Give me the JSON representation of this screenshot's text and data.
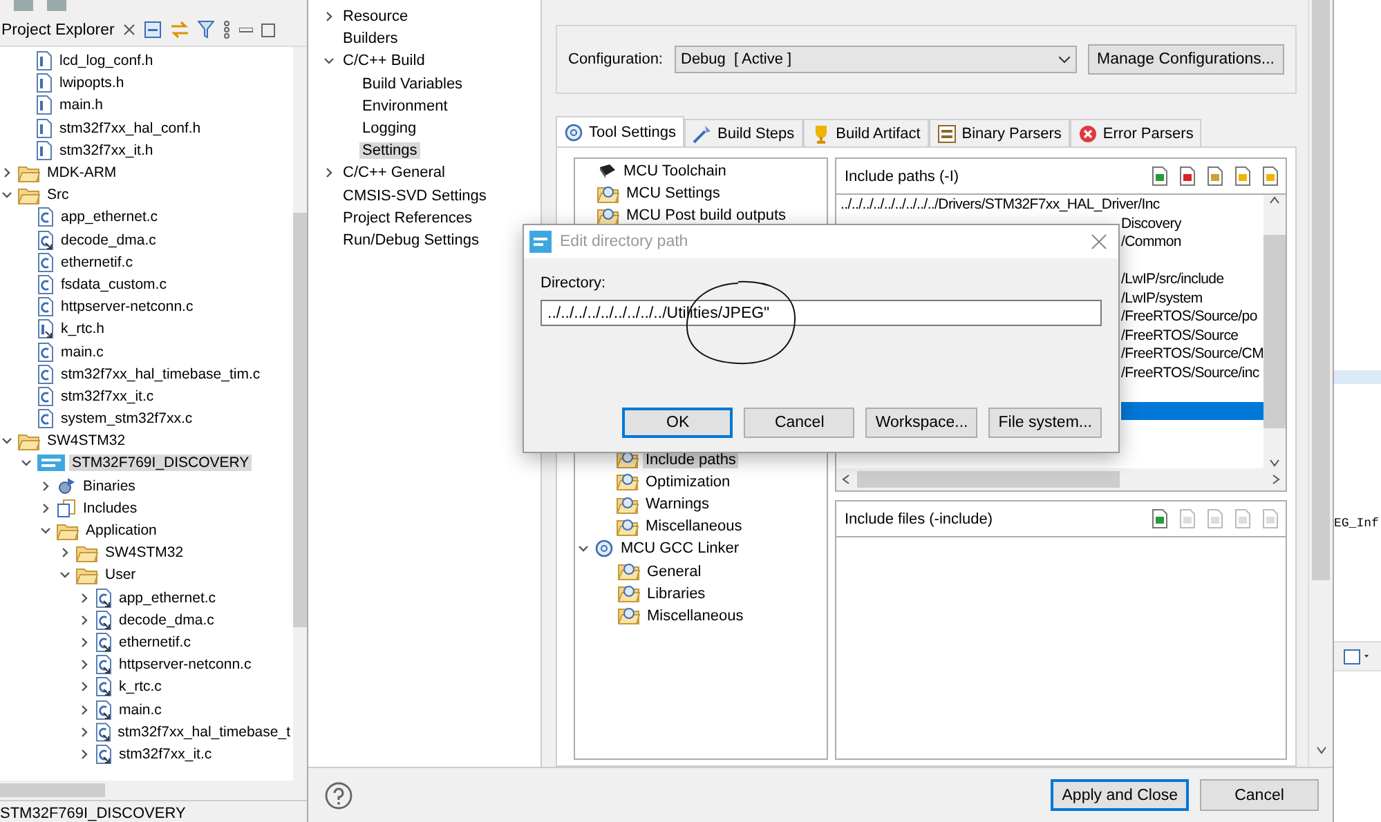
{
  "explorer": {
    "title": "Project Explorer",
    "partial_folder_items": [
      {
        "label": "lcd_log_conf.h",
        "kind": "h-file",
        "selected": false
      },
      {
        "label": "lwipopts.h",
        "kind": "h-file",
        "selected": false
      },
      {
        "label": "main.h",
        "kind": "h-file",
        "selected": false
      },
      {
        "label": "stm32f7xx_hal_conf.h",
        "kind": "h-file",
        "selected": false
      },
      {
        "label": "stm32f7xx_it.h",
        "kind": "h-file",
        "selected": false
      }
    ],
    "tree": [
      {
        "label": "MDK-ARM",
        "kind": "folder",
        "expanded": false,
        "selected": false
      },
      {
        "label": "Src",
        "kind": "folder",
        "expanded": true,
        "selected": false,
        "children": [
          {
            "label": "app_ethernet.c",
            "kind": "c-file",
            "selected": false
          },
          {
            "label": "decode_dma.c",
            "kind": "c-file-linked",
            "selected": false
          },
          {
            "label": "ethernetif.c",
            "kind": "c-file",
            "selected": false
          },
          {
            "label": "fsdata_custom.c",
            "kind": "c-file",
            "selected": false
          },
          {
            "label": "httpserver-netconn.c",
            "kind": "c-file",
            "selected": false
          },
          {
            "label": "k_rtc.h",
            "kind": "h-file-linked",
            "selected": false
          },
          {
            "label": "main.c",
            "kind": "c-file",
            "selected": false
          },
          {
            "label": "stm32f7xx_hal_timebase_tim.c",
            "kind": "c-file",
            "selected": false
          },
          {
            "label": "stm32f7xx_it.c",
            "kind": "c-file",
            "selected": false
          },
          {
            "label": "system_stm32f7xx.c",
            "kind": "c-file",
            "selected": false
          }
        ]
      },
      {
        "label": "SW4STM32",
        "kind": "folder",
        "expanded": true,
        "selected": false,
        "children": [
          {
            "label": "STM32F769I_DISCOVERY",
            "kind": "project",
            "expanded": true,
            "selected": true,
            "children": [
              {
                "label": "Binaries",
                "kind": "binaries",
                "expanded": false,
                "selected": false
              },
              {
                "label": "Includes",
                "kind": "includes",
                "expanded": false,
                "selected": false
              },
              {
                "label": "Application",
                "kind": "folder",
                "expanded": true,
                "selected": false,
                "children": [
                  {
                    "label": "SW4STM32",
                    "kind": "folder",
                    "expanded": false,
                    "selected": false
                  },
                  {
                    "label": "User",
                    "kind": "folder",
                    "expanded": true,
                    "selected": false,
                    "children": [
                      {
                        "label": "app_ethernet.c",
                        "kind": "c-file-linked",
                        "expanded": false,
                        "selected": false
                      },
                      {
                        "label": "decode_dma.c",
                        "kind": "c-file-linked",
                        "expanded": false,
                        "selected": false
                      },
                      {
                        "label": "ethernetif.c",
                        "kind": "c-file-linked",
                        "expanded": false,
                        "selected": false
                      },
                      {
                        "label": "httpserver-netconn.c",
                        "kind": "c-file-linked",
                        "expanded": false,
                        "selected": false
                      },
                      {
                        "label": "k_rtc.c",
                        "kind": "c-file-linked",
                        "expanded": false,
                        "selected": false
                      },
                      {
                        "label": "main.c",
                        "kind": "c-file-linked",
                        "expanded": false,
                        "selected": false
                      },
                      {
                        "label": "stm32f7xx_hal_timebase_t",
                        "kind": "c-file-linked",
                        "expanded": false,
                        "selected": false
                      },
                      {
                        "label": "stm32f7xx_it.c",
                        "kind": "c-file-linked",
                        "expanded": false,
                        "selected": false
                      }
                    ]
                  }
                ]
              }
            ]
          }
        ]
      }
    ],
    "status": "STM32F769I_DISCOVERY"
  },
  "properties": {
    "nav": [
      {
        "label": "Resource",
        "expanded": false,
        "selected": false
      },
      {
        "label": "Builders",
        "selected": false
      },
      {
        "label": "C/C++ Build",
        "expanded": true,
        "selected": false,
        "children": [
          {
            "label": "Build Variables",
            "selected": false
          },
          {
            "label": "Environment",
            "selected": false
          },
          {
            "label": "Logging",
            "selected": false
          },
          {
            "label": "Settings",
            "selected": true
          }
        ]
      },
      {
        "label": "C/C++ General",
        "expanded": false,
        "selected": false
      },
      {
        "label": "CMSIS-SVD Settings",
        "selected": false
      },
      {
        "label": "Project References",
        "selected": false
      },
      {
        "label": "Run/Debug Settings",
        "selected": false
      }
    ],
    "configuration": {
      "label": "Configuration:",
      "value": "Debug  [ Active ]",
      "manage_button": "Manage Configurations..."
    },
    "tabs": [
      {
        "label": "Tool Settings",
        "kind": "gear",
        "selected": true
      },
      {
        "label": "Build Steps",
        "kind": "wand",
        "selected": false
      },
      {
        "label": "Build Artifact",
        "kind": "trophy",
        "selected": false
      },
      {
        "label": "Binary Parsers",
        "kind": "binary",
        "selected": false
      },
      {
        "label": "Error Parsers",
        "kind": "error",
        "selected": false
      }
    ],
    "tool_tree_top": [
      {
        "label": "MCU Toolchain",
        "kind": "chip",
        "selected": false
      },
      {
        "label": "MCU Settings",
        "kind": "tool-folder",
        "selected": false
      },
      {
        "label": "MCU Post build outputs",
        "kind": "tool-folder",
        "selected": false
      }
    ],
    "tool_tree_bottom": [
      {
        "label": "Include paths",
        "kind": "tool-folder",
        "selected": true
      },
      {
        "label": "Optimization",
        "kind": "tool-folder",
        "selected": false
      },
      {
        "label": "Warnings",
        "kind": "tool-folder",
        "selected": false
      },
      {
        "label": "Miscellaneous",
        "kind": "tool-folder",
        "selected": false
      }
    ],
    "tool_tree_linker": {
      "label": "MCU GCC Linker",
      "kind": "gear",
      "expanded": true,
      "selected": false,
      "children": [
        {
          "label": "General",
          "kind": "tool-folder",
          "selected": false
        },
        {
          "label": "Libraries",
          "kind": "tool-folder",
          "selected": false
        },
        {
          "label": "Miscellaneous",
          "kind": "tool-folder",
          "selected": false
        }
      ]
    },
    "include_paths": {
      "title": "Include paths (-I)",
      "rows": [
        {
          "text": "../../../../../../../../../Drivers/STM32F7xx_HAL_Driver/Inc",
          "clipped": false,
          "selected": false
        },
        {
          "text": "Discovery",
          "clipped": true,
          "selected": false
        },
        {
          "text": "/Common",
          "clipped": true,
          "selected": false
        },
        {
          "clipped": true,
          "selected": false
        },
        {
          "text": "/LwIP/src/include",
          "clipped": true,
          "selected": false
        },
        {
          "text": "/LwIP/system",
          "clipped": true,
          "selected": false
        },
        {
          "text": "/FreeRTOS/Source/po",
          "clipped": true,
          "selected": false
        },
        {
          "text": "/FreeRTOS/Source",
          "clipped": true,
          "selected": false
        },
        {
          "text": "/FreeRTOS/Source/CM",
          "clipped": true,
          "selected": false
        },
        {
          "text": "/FreeRTOS/Source/inc",
          "clipped": true,
          "selected": false
        },
        {
          "clipped": true,
          "selected": false
        },
        {
          "clipped": true,
          "selected": true
        }
      ]
    },
    "include_files": {
      "title": "Include files (-include)"
    },
    "buttons": [
      {
        "label": "Apply and Close",
        "default": true
      },
      {
        "label": "Cancel",
        "default": false
      }
    ]
  },
  "edit_dialog": {
    "title": "Edit directory path",
    "label": "Directory:",
    "value": "../../../../../../../../../Utilities/JPEG\"",
    "buttons": [
      {
        "label": "OK",
        "default": true
      },
      {
        "label": "Cancel",
        "default": false
      },
      {
        "label": "Workspace...",
        "default": false
      },
      {
        "label": "File system...",
        "default": false
      }
    ]
  },
  "editor": {
    "fragment": "EG_Inf"
  }
}
